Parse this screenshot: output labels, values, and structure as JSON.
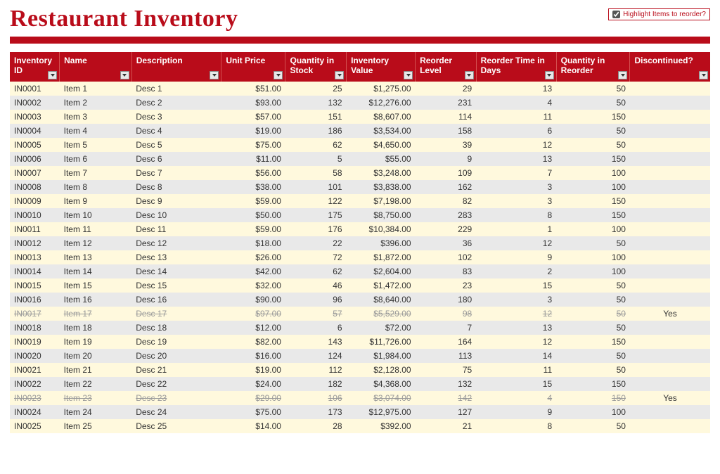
{
  "title": "Restaurant Inventory",
  "highlight": {
    "label": "Highlight Items to reorder?",
    "checked": true
  },
  "columns": [
    "Inventory ID",
    "Name",
    "Description",
    "Unit Price",
    "Quantity in Stock",
    "Inventory Value",
    "Reorder Level",
    "Reorder Time in Days",
    "Quantity in Reorder",
    "Discontinued?"
  ],
  "rows": [
    {
      "id": "IN0001",
      "name": "Item 1",
      "desc": "Desc 1",
      "price": "$51.00",
      "qty": "25",
      "value": "$1,275.00",
      "reorder": "29",
      "days": "13",
      "qre": "50",
      "disc": "",
      "tone": "yellow"
    },
    {
      "id": "IN0002",
      "name": "Item 2",
      "desc": "Desc 2",
      "price": "$93.00",
      "qty": "132",
      "value": "$12,276.00",
      "reorder": "231",
      "days": "4",
      "qre": "50",
      "disc": "",
      "tone": "gray"
    },
    {
      "id": "IN0003",
      "name": "Item 3",
      "desc": "Desc 3",
      "price": "$57.00",
      "qty": "151",
      "value": "$8,607.00",
      "reorder": "114",
      "days": "11",
      "qre": "150",
      "disc": "",
      "tone": "yellow"
    },
    {
      "id": "IN0004",
      "name": "Item 4",
      "desc": "Desc 4",
      "price": "$19.00",
      "qty": "186",
      "value": "$3,534.00",
      "reorder": "158",
      "days": "6",
      "qre": "50",
      "disc": "",
      "tone": "gray"
    },
    {
      "id": "IN0005",
      "name": "Item 5",
      "desc": "Desc 5",
      "price": "$75.00",
      "qty": "62",
      "value": "$4,650.00",
      "reorder": "39",
      "days": "12",
      "qre": "50",
      "disc": "",
      "tone": "yellow"
    },
    {
      "id": "IN0006",
      "name": "Item 6",
      "desc": "Desc 6",
      "price": "$11.00",
      "qty": "5",
      "value": "$55.00",
      "reorder": "9",
      "days": "13",
      "qre": "150",
      "disc": "",
      "tone": "gray"
    },
    {
      "id": "IN0007",
      "name": "Item 7",
      "desc": "Desc 7",
      "price": "$56.00",
      "qty": "58",
      "value": "$3,248.00",
      "reorder": "109",
      "days": "7",
      "qre": "100",
      "disc": "",
      "tone": "yellow"
    },
    {
      "id": "IN0008",
      "name": "Item 8",
      "desc": "Desc 8",
      "price": "$38.00",
      "qty": "101",
      "value": "$3,838.00",
      "reorder": "162",
      "days": "3",
      "qre": "100",
      "disc": "",
      "tone": "gray"
    },
    {
      "id": "IN0009",
      "name": "Item 9",
      "desc": "Desc 9",
      "price": "$59.00",
      "qty": "122",
      "value": "$7,198.00",
      "reorder": "82",
      "days": "3",
      "qre": "150",
      "disc": "",
      "tone": "yellow"
    },
    {
      "id": "IN0010",
      "name": "Item 10",
      "desc": "Desc 10",
      "price": "$50.00",
      "qty": "175",
      "value": "$8,750.00",
      "reorder": "283",
      "days": "8",
      "qre": "150",
      "disc": "",
      "tone": "gray"
    },
    {
      "id": "IN0011",
      "name": "Item 11",
      "desc": "Desc 11",
      "price": "$59.00",
      "qty": "176",
      "value": "$10,384.00",
      "reorder": "229",
      "days": "1",
      "qre": "100",
      "disc": "",
      "tone": "yellow"
    },
    {
      "id": "IN0012",
      "name": "Item 12",
      "desc": "Desc 12",
      "price": "$18.00",
      "qty": "22",
      "value": "$396.00",
      "reorder": "36",
      "days": "12",
      "qre": "50",
      "disc": "",
      "tone": "gray"
    },
    {
      "id": "IN0013",
      "name": "Item 13",
      "desc": "Desc 13",
      "price": "$26.00",
      "qty": "72",
      "value": "$1,872.00",
      "reorder": "102",
      "days": "9",
      "qre": "100",
      "disc": "",
      "tone": "yellow"
    },
    {
      "id": "IN0014",
      "name": "Item 14",
      "desc": "Desc 14",
      "price": "$42.00",
      "qty": "62",
      "value": "$2,604.00",
      "reorder": "83",
      "days": "2",
      "qre": "100",
      "disc": "",
      "tone": "gray"
    },
    {
      "id": "IN0015",
      "name": "Item 15",
      "desc": "Desc 15",
      "price": "$32.00",
      "qty": "46",
      "value": "$1,472.00",
      "reorder": "23",
      "days": "15",
      "qre": "50",
      "disc": "",
      "tone": "yellow"
    },
    {
      "id": "IN0016",
      "name": "Item 16",
      "desc": "Desc 16",
      "price": "$90.00",
      "qty": "96",
      "value": "$8,640.00",
      "reorder": "180",
      "days": "3",
      "qre": "50",
      "disc": "",
      "tone": "gray"
    },
    {
      "id": "IN0017",
      "name": "Item 17",
      "desc": "Desc 17",
      "price": "$97.00",
      "qty": "57",
      "value": "$5,529.00",
      "reorder": "98",
      "days": "12",
      "qre": "50",
      "disc": "Yes",
      "tone": "yellow",
      "discontinued": true
    },
    {
      "id": "IN0018",
      "name": "Item 18",
      "desc": "Desc 18",
      "price": "$12.00",
      "qty": "6",
      "value": "$72.00",
      "reorder": "7",
      "days": "13",
      "qre": "50",
      "disc": "",
      "tone": "gray"
    },
    {
      "id": "IN0019",
      "name": "Item 19",
      "desc": "Desc 19",
      "price": "$82.00",
      "qty": "143",
      "value": "$11,726.00",
      "reorder": "164",
      "days": "12",
      "qre": "150",
      "disc": "",
      "tone": "yellow"
    },
    {
      "id": "IN0020",
      "name": "Item 20",
      "desc": "Desc 20",
      "price": "$16.00",
      "qty": "124",
      "value": "$1,984.00",
      "reorder": "113",
      "days": "14",
      "qre": "50",
      "disc": "",
      "tone": "gray"
    },
    {
      "id": "IN0021",
      "name": "Item 21",
      "desc": "Desc 21",
      "price": "$19.00",
      "qty": "112",
      "value": "$2,128.00",
      "reorder": "75",
      "days": "11",
      "qre": "50",
      "disc": "",
      "tone": "yellow"
    },
    {
      "id": "IN0022",
      "name": "Item 22",
      "desc": "Desc 22",
      "price": "$24.00",
      "qty": "182",
      "value": "$4,368.00",
      "reorder": "132",
      "days": "15",
      "qre": "150",
      "disc": "",
      "tone": "gray"
    },
    {
      "id": "IN0023",
      "name": "Item 23",
      "desc": "Desc 23",
      "price": "$29.00",
      "qty": "106",
      "value": "$3,074.00",
      "reorder": "142",
      "days": "4",
      "qre": "150",
      "disc": "Yes",
      "tone": "yellow",
      "discontinued": true
    },
    {
      "id": "IN0024",
      "name": "Item 24",
      "desc": "Desc 24",
      "price": "$75.00",
      "qty": "173",
      "value": "$12,975.00",
      "reorder": "127",
      "days": "9",
      "qre": "100",
      "disc": "",
      "tone": "gray"
    },
    {
      "id": "IN0025",
      "name": "Item 25",
      "desc": "Desc 25",
      "price": "$14.00",
      "qty": "28",
      "value": "$392.00",
      "reorder": "21",
      "days": "8",
      "qre": "50",
      "disc": "",
      "tone": "yellow"
    }
  ]
}
